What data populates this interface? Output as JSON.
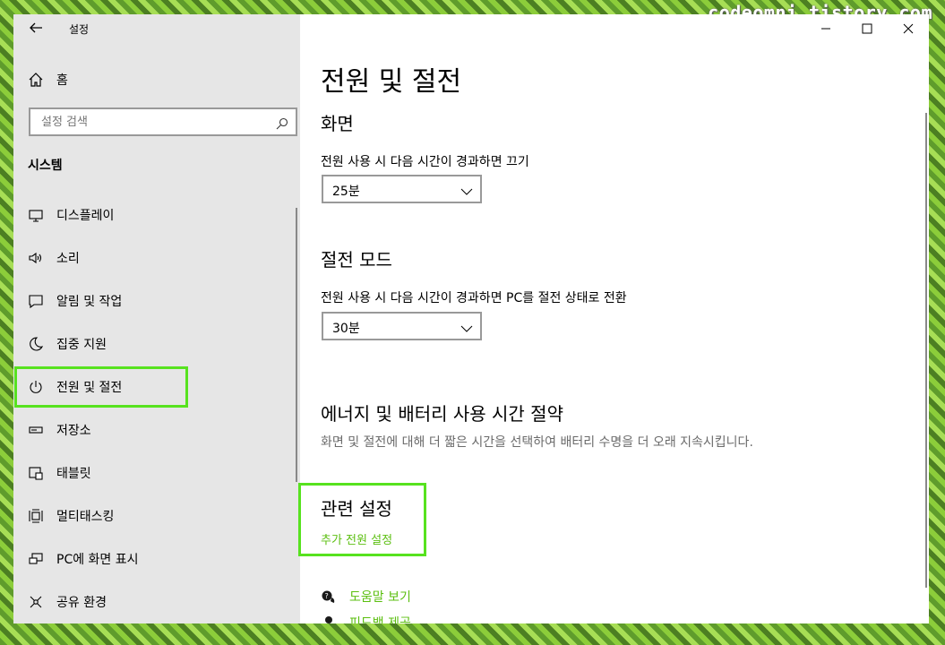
{
  "watermark": "codeomni.tistory.com",
  "window": {
    "title": "설정"
  },
  "sidebar": {
    "home_label": "홈",
    "search_placeholder": "설정 검색",
    "section_title": "시스템",
    "items": [
      {
        "label": "디스플레이",
        "icon": "monitor-icon"
      },
      {
        "label": "소리",
        "icon": "speaker-icon"
      },
      {
        "label": "알림 및 작업",
        "icon": "message-icon"
      },
      {
        "label": "집중 지원",
        "icon": "moon-icon"
      },
      {
        "label": "전원 및 절전",
        "icon": "power-icon"
      },
      {
        "label": "저장소",
        "icon": "storage-icon"
      },
      {
        "label": "태블릿",
        "icon": "tablet-icon"
      },
      {
        "label": "멀티태스킹",
        "icon": "multitask-icon"
      },
      {
        "label": "PC에 화면 표시",
        "icon": "project-icon"
      },
      {
        "label": "공유 환경",
        "icon": "share-icon"
      }
    ]
  },
  "main": {
    "page_title": "전원 및 절전",
    "screen": {
      "title": "화면",
      "label": "전원 사용 시 다음 시간이 경과하면 끄기",
      "value": "25분"
    },
    "sleep": {
      "title": "절전 모드",
      "label": "전원 사용 시 다음 시간이 경과하면 PC를 절전 상태로 전환",
      "value": "30분"
    },
    "energy": {
      "title": "에너지 및 배터리 사용 시간 절약",
      "desc": "화면 및 절전에 대해 더 짧은 시간을 선택하여 배터리 수명을 더 오래 지속시킵니다."
    },
    "related": {
      "title": "관련 설정",
      "link": "추가 전원 설정"
    },
    "help": {
      "help_label": "도움말 보기",
      "feedback_label": "피드백 제공"
    }
  },
  "colors": {
    "highlight": "#57e21f",
    "link": "#5bbf10",
    "sidebar_bg": "#e6e6e6"
  }
}
